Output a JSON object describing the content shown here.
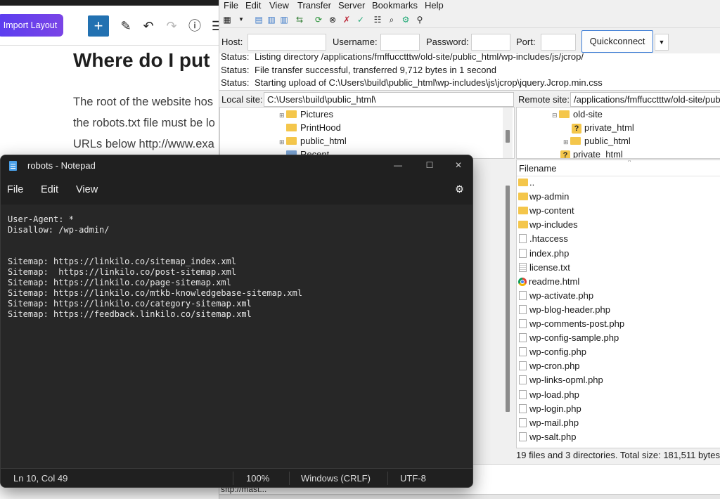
{
  "wp": {
    "import_label": "Import Layout",
    "heading": "Where do I put",
    "para": [
      "The root of the website hos",
      "the robots.txt file must be lo",
      "URLs below http://www.exa"
    ]
  },
  "filezilla": {
    "menu": [
      "File",
      "Edit",
      "View",
      "Transfer",
      "Server",
      "Bookmarks",
      "Help"
    ],
    "quickconnect": {
      "host_label": "Host:",
      "username_label": "Username:",
      "password_label": "Password:",
      "port_label": "Port:",
      "button_label": "Quickconnect"
    },
    "log": [
      {
        "key": "Status:",
        "text": "Listing directory /applications/fmffucctttw/old-site/public_html/wp-includes/js/jcrop/"
      },
      {
        "key": "Status:",
        "text": "File transfer successful, transferred 9,712 bytes in 1 second"
      },
      {
        "key": "Status:",
        "text": "Starting upload of C:\\Users\\build\\public_html\\wp-includes\\js\\jcrop\\jquery.Jcrop.min.css"
      }
    ],
    "local_site": {
      "label": "Local site:",
      "path": "C:\\Users\\build\\public_html\\"
    },
    "remote_site": {
      "label": "Remote site:",
      "path": "/applications/fmffucctttw/old-site/public_html"
    },
    "local_tree": [
      "Pictures",
      "PrintHood",
      "public_html",
      "Recent"
    ],
    "remote_tree": [
      "old-site",
      "private_html",
      "public_html",
      "private_html"
    ],
    "filelist": {
      "header": "Filename",
      "files": [
        {
          "name": "..",
          "type": "dir"
        },
        {
          "name": "wp-admin",
          "type": "dir"
        },
        {
          "name": "wp-content",
          "type": "dir"
        },
        {
          "name": "wp-includes",
          "type": "dir"
        },
        {
          "name": ".htaccess",
          "type": "file"
        },
        {
          "name": "index.php",
          "type": "file"
        },
        {
          "name": "license.txt",
          "type": "txt"
        },
        {
          "name": "readme.html",
          "type": "html"
        },
        {
          "name": "wp-activate.php",
          "type": "file"
        },
        {
          "name": "wp-blog-header.php",
          "type": "file"
        },
        {
          "name": "wp-comments-post.php",
          "type": "file"
        },
        {
          "name": "wp-config-sample.php",
          "type": "file"
        },
        {
          "name": "wp-config.php",
          "type": "file"
        },
        {
          "name": "wp-cron.php",
          "type": "file"
        },
        {
          "name": "wp-links-opml.php",
          "type": "file"
        },
        {
          "name": "wp-load.php",
          "type": "file"
        },
        {
          "name": "wp-login.php",
          "type": "file"
        },
        {
          "name": "wp-mail.php",
          "type": "file"
        },
        {
          "name": "wp-salt.php",
          "type": "file"
        }
      ],
      "summary": "19 files and 3 directories. Total size: 181,511 bytes"
    },
    "queue_item": "sftp://mast..."
  },
  "notepad": {
    "title": "robots - Notepad",
    "menu": [
      "File",
      "Edit",
      "View"
    ],
    "lines": [
      "User-Agent: *",
      "Disallow: /wp-admin/",
      "",
      "",
      "Sitemap: https://linkilo.co/sitemap_index.xml",
      "Sitemap:  https://linkilo.co/post-sitemap.xml",
      "Sitemap: https://linkilo.co/page-sitemap.xml",
      "Sitemap: https://linkilo.co/mtkb-knowledgebase-sitemap.xml",
      "Sitemap: https://linkilo.co/category-sitemap.xml",
      "Sitemap: https://feedback.linkilo.co/sitemap.xml"
    ],
    "status": {
      "position": "Ln 10, Col 49",
      "zoom": "100%",
      "line_ending": "Windows (CRLF)",
      "encoding": "UTF-8"
    }
  }
}
